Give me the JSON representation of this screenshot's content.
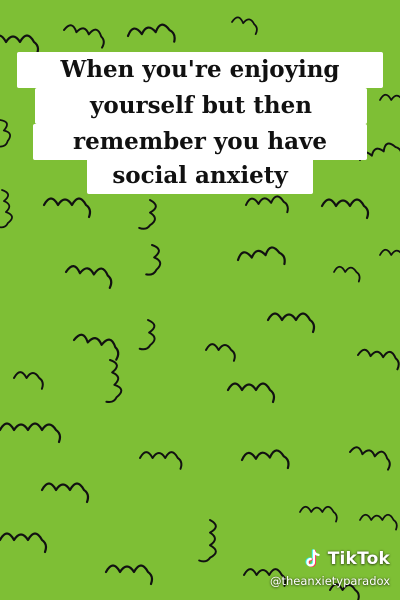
{
  "caption": {
    "lines": [
      "When you're enjoying",
      "yourself but then",
      "remember you have",
      "social anxiety"
    ]
  },
  "watermark": {
    "brand": "TikTok",
    "handle": "@theanxietyparadox",
    "icon": "tiktok-logo-icon"
  },
  "colors": {
    "background": "#7ebf35",
    "doodle_stroke": "#111111",
    "caption_bg": "#ffffff"
  }
}
